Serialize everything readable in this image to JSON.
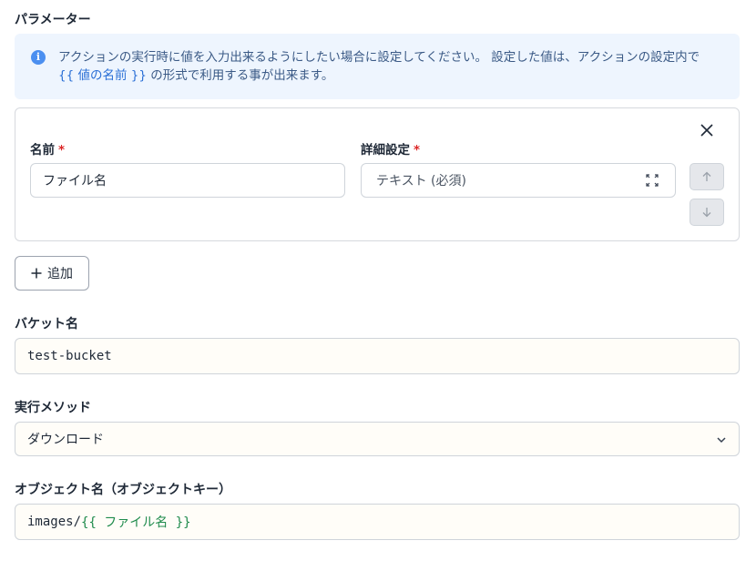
{
  "parameters": {
    "title": "パラメーター",
    "info": {
      "line1": "アクションの実行時に値を入力出来るようにしたい場合に設定してください。 設定した値は、アクションの設定内で",
      "code": "{{ 値の名前 }}",
      "line2_rest": " の形式で利用する事が出来ます。"
    },
    "row": {
      "name_label": "名前",
      "name_value": "ファイル名",
      "detail_label": "詳細設定",
      "detail_value": "テキスト (必須)",
      "required_mark": "*"
    },
    "add_label": "追加"
  },
  "bucket": {
    "label": "バケット名",
    "value": "test-bucket"
  },
  "method": {
    "label": "実行メソッド",
    "value": "ダウンロード"
  },
  "object": {
    "label": "オブジェクト名（オブジェクトキー）",
    "value_prefix": "images/",
    "value_template": "{{ ファイル名 }}"
  },
  "icons": {
    "info": "info-icon",
    "close": "close-icon",
    "expand": "expand-icon",
    "up": "arrow-up-icon",
    "down": "arrow-down-icon",
    "add": "plus-icon",
    "chevron": "chevron-down-icon"
  },
  "colors": {
    "info_bg": "#eef5fe",
    "info_icon": "#4b8ff0",
    "required": "#dc2626",
    "template": "#1f8b4c"
  }
}
